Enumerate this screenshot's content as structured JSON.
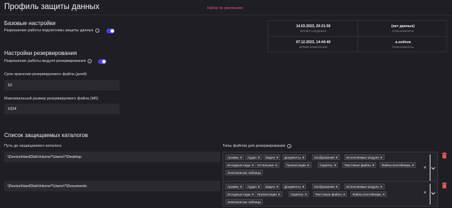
{
  "page": {
    "title": "Профиль защиты данных",
    "default_badge": "Набор по умолчанию"
  },
  "basic": {
    "heading": "Базовые настройки",
    "allow_label": "Разрешение работы подсистемы защиты данных",
    "enabled": true
  },
  "backup": {
    "heading": "Настройки резервирования",
    "allow_label": "Разрешение работы модуля резервирования",
    "enabled": true,
    "retention_label": "Срок хранения резервируемого файла (дней)",
    "retention_value": "10",
    "max_size_label": "Максимальный размер резервируемого файла (Мб)",
    "max_size_value": "1024"
  },
  "meta": {
    "created_value": "14.03.2023, 20:21:56",
    "created_label": "ВРЕМЯ СОЗДАНИЯ",
    "creator_value": "(нет данных)",
    "creator_label": "ПОЛЬЗОВАТЕЛЬ",
    "modified_value": "07.12.2023, 14:44:40",
    "modified_label": "ВРЕМЯ ИЗМЕНЕНИЯ",
    "modifier_value": "a.sedova",
    "modifier_label": "ПОЛЬЗОВАТЕЛЬ"
  },
  "catalogs": {
    "heading": "Список защищаемых каталогов",
    "path_label": "Путь до защищаемого каталога",
    "types_label": "Типы файлов для резервирования",
    "clear_glyph": "×",
    "items": [
      {
        "path": "\\Device\\HardDiskVolume*\\Users\\*\\Desktop",
        "tags": [
          "Архивы",
          "Аудио",
          "Видео",
          "Документы",
          "Изображения",
          "Исполняемые модули",
          "Исходные коды",
          "Остальные",
          "Презентации",
          "Скрипты",
          "Текстовые файлы",
          "Файлы-контейнеры",
          "Электронные таблицы"
        ]
      },
      {
        "path": "\\Device\\HardDiskVolume*\\Users\\*\\Documents",
        "tags": [
          "Архивы",
          "Аудио",
          "Видео",
          "Документы",
          "Изображения",
          "Исполняемые модули",
          "Исходные коды",
          "Презентации",
          "Скрипты",
          "Текстовые файлы",
          "Файлы-контейнеры",
          "Электронные таблицы"
        ]
      }
    ]
  },
  "colors": {
    "background": "#1f1e24",
    "accent_toggle": "#4b3fd6",
    "badge": "#e0549a",
    "trash": "#e05a5a"
  }
}
